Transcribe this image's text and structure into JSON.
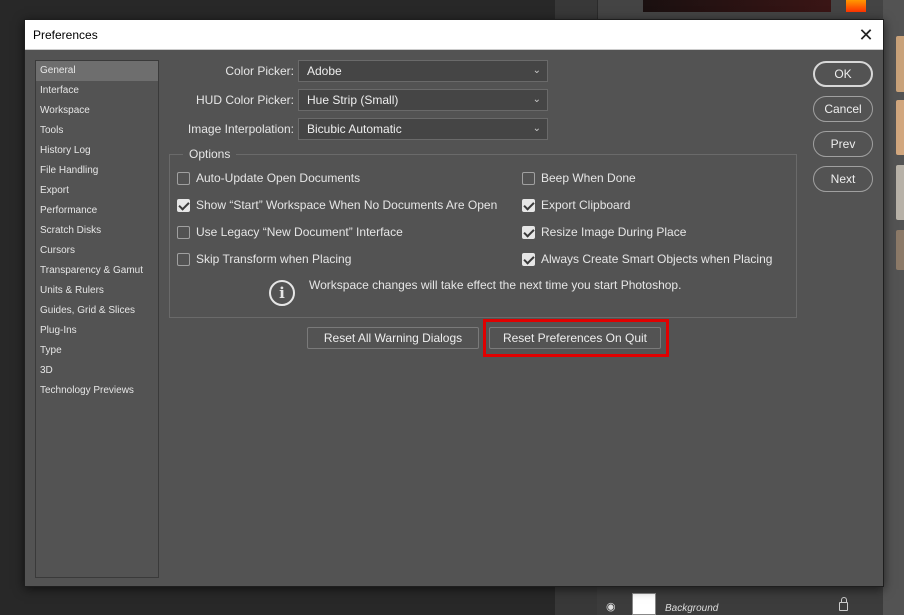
{
  "background": {
    "layer_name": "Background"
  },
  "dialog": {
    "title": "Preferences",
    "close_glyph": "✕"
  },
  "nav": {
    "items": [
      {
        "label": "General",
        "active": true
      },
      {
        "label": "Interface"
      },
      {
        "label": "Workspace"
      },
      {
        "label": "Tools"
      },
      {
        "label": "History Log"
      },
      {
        "label": "File Handling"
      },
      {
        "label": "Export"
      },
      {
        "label": "Performance"
      },
      {
        "label": "Scratch Disks"
      },
      {
        "label": "Cursors"
      },
      {
        "label": "Transparency & Gamut"
      },
      {
        "label": "Units & Rulers"
      },
      {
        "label": "Guides, Grid & Slices"
      },
      {
        "label": "Plug-Ins"
      },
      {
        "label": "Type"
      },
      {
        "label": "3D"
      },
      {
        "label": "Technology Previews"
      }
    ]
  },
  "fields": {
    "color_picker": {
      "label": "Color Picker:",
      "value": "Adobe"
    },
    "hud_color_picker": {
      "label": "HUD Color Picker:",
      "value": "Hue Strip (Small)"
    },
    "image_interpolation": {
      "label": "Image Interpolation:",
      "value": "Bicubic Automatic"
    }
  },
  "options": {
    "legend": "Options",
    "left": [
      {
        "label": "Auto-Update Open Documents",
        "checked": false
      },
      {
        "label": "Show “Start” Workspace When No Documents Are Open",
        "checked": true
      },
      {
        "label": "Use Legacy “New Document” Interface",
        "checked": false
      },
      {
        "label": "Skip Transform when Placing",
        "checked": false
      }
    ],
    "right": [
      {
        "label": "Beep When Done",
        "checked": false
      },
      {
        "label": "Export Clipboard",
        "checked": true
      },
      {
        "label": "Resize Image During Place",
        "checked": true
      },
      {
        "label": "Always Create Smart Objects when Placing",
        "checked": true
      }
    ],
    "info_text": "Workspace changes will take effect the next time you start Photoshop."
  },
  "buttons": {
    "reset_warnings": "Reset All Warning Dialogs",
    "reset_prefs": "Reset Preferences On Quit",
    "ok": "OK",
    "cancel": "Cancel",
    "prev": "Prev",
    "next": "Next"
  },
  "colors": {
    "highlight": "#e00000",
    "dialog_bg": "#535353"
  }
}
